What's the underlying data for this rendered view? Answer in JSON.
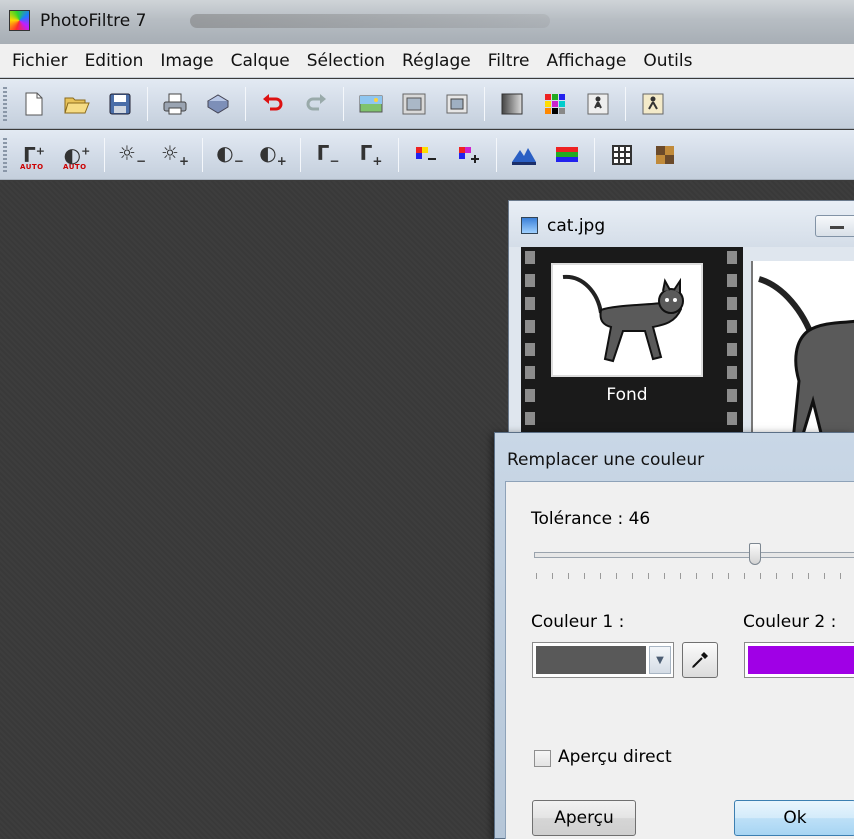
{
  "app": {
    "title": "PhotoFiltre 7"
  },
  "menu": [
    "Fichier",
    "Edition",
    "Image",
    "Calque",
    "Sélection",
    "Réglage",
    "Filtre",
    "Affichage",
    "Outils"
  ],
  "toolbar1": [
    "new-file-icon",
    "open-folder-icon",
    "save-icon",
    "print-icon",
    "scan-icon",
    "undo-icon",
    "redo-icon",
    "image-size-icon",
    "canvas-size-icon",
    "crop-icon",
    "gradient-icon",
    "palette-icon",
    "animation-icon",
    "automate-icon"
  ],
  "toolbar2": {
    "gamma_auto": "AUTO",
    "contrast_auto": "AUTO"
  },
  "image_window": {
    "title": "cat.jpg",
    "layer_label": "Fond"
  },
  "dialog": {
    "title": "Remplacer une couleur",
    "tolerance_label": "Tolérance : 46",
    "tolerance_value": 46,
    "color1_label": "Couleur 1 :",
    "color2_label": "Couleur 2 :",
    "color1": "#595959",
    "color2": "#a000e6",
    "preview_checkbox_label": "Aperçu direct",
    "preview_checked": false,
    "preview_button": "Aperçu",
    "ok_button": "Ok"
  }
}
